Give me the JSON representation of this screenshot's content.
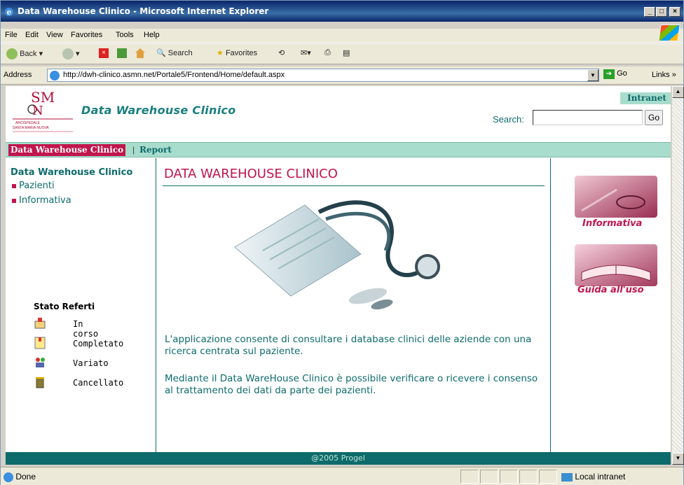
{
  "window": {
    "title": "Data Warehouse Clinico - Microsoft Internet Explorer"
  },
  "menu": [
    "File",
    "Edit",
    "View",
    "Favorites",
    "Tools",
    "Help"
  ],
  "toolbar": {
    "back": "Back",
    "search": "Search",
    "favorites": "Favorites"
  },
  "address": {
    "label": "Address",
    "url": "http://dwh-clinico.asmn.net/Portale5/Frontend/Home/default.aspx",
    "go": "Go",
    "links": "Links"
  },
  "header": {
    "logo_text": "ARCISPEDALE SANTA MARIA NUOVA",
    "brand": "Data Warehouse Clinico",
    "tab": "Intranet",
    "search_label": "Search:",
    "search_value": "",
    "search_go": "Go"
  },
  "nav": {
    "active": "Data Warehouse Clinico",
    "separator": "|",
    "report": "Report"
  },
  "sidebar": {
    "title": "Data Warehouse Clinico",
    "links": [
      "Pazienti",
      "Informativa"
    ],
    "stato_title": "Stato Referti",
    "stati": [
      {
        "label": "In corso",
        "icon": "in-progress-icon"
      },
      {
        "label": "Completato",
        "icon": "completed-icon"
      },
      {
        "label": "Variato",
        "icon": "changed-icon"
      },
      {
        "label": "Cancellato",
        "icon": "deleted-icon"
      }
    ]
  },
  "main": {
    "title": "DATA WAREHOUSE CLINICO",
    "para1": "L'applicazione consente di consultare i database clinici delle aziende con una ricerca centrata sul paziente.",
    "para2": "Mediante il Data WareHouse Clinico è possibile verificare o ricevere i consenso al trattamento dei dati da parte dei pazienti."
  },
  "right": {
    "card1": "Informativa",
    "card2": "Guida all'uso"
  },
  "footer": "@2005 Progel",
  "status": {
    "left": "Done",
    "zone": "Local intranet"
  },
  "colors": {
    "teal": "#0d6b6b",
    "crimson": "#c0154d",
    "mint": "#a8dccc"
  }
}
